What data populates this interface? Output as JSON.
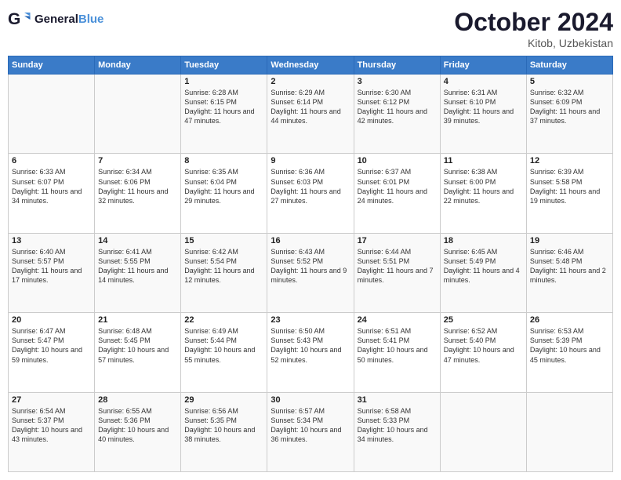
{
  "logo": {
    "text_general": "General",
    "text_blue": "Blue"
  },
  "title": "October 2024",
  "location": "Kitob, Uzbekistan",
  "days_of_week": [
    "Sunday",
    "Monday",
    "Tuesday",
    "Wednesday",
    "Thursday",
    "Friday",
    "Saturday"
  ],
  "weeks": [
    [
      {
        "day": "",
        "sunrise": "",
        "sunset": "",
        "daylight": ""
      },
      {
        "day": "",
        "sunrise": "",
        "sunset": "",
        "daylight": ""
      },
      {
        "day": "1",
        "sunrise": "Sunrise: 6:28 AM",
        "sunset": "Sunset: 6:15 PM",
        "daylight": "Daylight: 11 hours and 47 minutes."
      },
      {
        "day": "2",
        "sunrise": "Sunrise: 6:29 AM",
        "sunset": "Sunset: 6:14 PM",
        "daylight": "Daylight: 11 hours and 44 minutes."
      },
      {
        "day": "3",
        "sunrise": "Sunrise: 6:30 AM",
        "sunset": "Sunset: 6:12 PM",
        "daylight": "Daylight: 11 hours and 42 minutes."
      },
      {
        "day": "4",
        "sunrise": "Sunrise: 6:31 AM",
        "sunset": "Sunset: 6:10 PM",
        "daylight": "Daylight: 11 hours and 39 minutes."
      },
      {
        "day": "5",
        "sunrise": "Sunrise: 6:32 AM",
        "sunset": "Sunset: 6:09 PM",
        "daylight": "Daylight: 11 hours and 37 minutes."
      }
    ],
    [
      {
        "day": "6",
        "sunrise": "Sunrise: 6:33 AM",
        "sunset": "Sunset: 6:07 PM",
        "daylight": "Daylight: 11 hours and 34 minutes."
      },
      {
        "day": "7",
        "sunrise": "Sunrise: 6:34 AM",
        "sunset": "Sunset: 6:06 PM",
        "daylight": "Daylight: 11 hours and 32 minutes."
      },
      {
        "day": "8",
        "sunrise": "Sunrise: 6:35 AM",
        "sunset": "Sunset: 6:04 PM",
        "daylight": "Daylight: 11 hours and 29 minutes."
      },
      {
        "day": "9",
        "sunrise": "Sunrise: 6:36 AM",
        "sunset": "Sunset: 6:03 PM",
        "daylight": "Daylight: 11 hours and 27 minutes."
      },
      {
        "day": "10",
        "sunrise": "Sunrise: 6:37 AM",
        "sunset": "Sunset: 6:01 PM",
        "daylight": "Daylight: 11 hours and 24 minutes."
      },
      {
        "day": "11",
        "sunrise": "Sunrise: 6:38 AM",
        "sunset": "Sunset: 6:00 PM",
        "daylight": "Daylight: 11 hours and 22 minutes."
      },
      {
        "day": "12",
        "sunrise": "Sunrise: 6:39 AM",
        "sunset": "Sunset: 5:58 PM",
        "daylight": "Daylight: 11 hours and 19 minutes."
      }
    ],
    [
      {
        "day": "13",
        "sunrise": "Sunrise: 6:40 AM",
        "sunset": "Sunset: 5:57 PM",
        "daylight": "Daylight: 11 hours and 17 minutes."
      },
      {
        "day": "14",
        "sunrise": "Sunrise: 6:41 AM",
        "sunset": "Sunset: 5:55 PM",
        "daylight": "Daylight: 11 hours and 14 minutes."
      },
      {
        "day": "15",
        "sunrise": "Sunrise: 6:42 AM",
        "sunset": "Sunset: 5:54 PM",
        "daylight": "Daylight: 11 hours and 12 minutes."
      },
      {
        "day": "16",
        "sunrise": "Sunrise: 6:43 AM",
        "sunset": "Sunset: 5:52 PM",
        "daylight": "Daylight: 11 hours and 9 minutes."
      },
      {
        "day": "17",
        "sunrise": "Sunrise: 6:44 AM",
        "sunset": "Sunset: 5:51 PM",
        "daylight": "Daylight: 11 hours and 7 minutes."
      },
      {
        "day": "18",
        "sunrise": "Sunrise: 6:45 AM",
        "sunset": "Sunset: 5:49 PM",
        "daylight": "Daylight: 11 hours and 4 minutes."
      },
      {
        "day": "19",
        "sunrise": "Sunrise: 6:46 AM",
        "sunset": "Sunset: 5:48 PM",
        "daylight": "Daylight: 11 hours and 2 minutes."
      }
    ],
    [
      {
        "day": "20",
        "sunrise": "Sunrise: 6:47 AM",
        "sunset": "Sunset: 5:47 PM",
        "daylight": "Daylight: 10 hours and 59 minutes."
      },
      {
        "day": "21",
        "sunrise": "Sunrise: 6:48 AM",
        "sunset": "Sunset: 5:45 PM",
        "daylight": "Daylight: 10 hours and 57 minutes."
      },
      {
        "day": "22",
        "sunrise": "Sunrise: 6:49 AM",
        "sunset": "Sunset: 5:44 PM",
        "daylight": "Daylight: 10 hours and 55 minutes."
      },
      {
        "day": "23",
        "sunrise": "Sunrise: 6:50 AM",
        "sunset": "Sunset: 5:43 PM",
        "daylight": "Daylight: 10 hours and 52 minutes."
      },
      {
        "day": "24",
        "sunrise": "Sunrise: 6:51 AM",
        "sunset": "Sunset: 5:41 PM",
        "daylight": "Daylight: 10 hours and 50 minutes."
      },
      {
        "day": "25",
        "sunrise": "Sunrise: 6:52 AM",
        "sunset": "Sunset: 5:40 PM",
        "daylight": "Daylight: 10 hours and 47 minutes."
      },
      {
        "day": "26",
        "sunrise": "Sunrise: 6:53 AM",
        "sunset": "Sunset: 5:39 PM",
        "daylight": "Daylight: 10 hours and 45 minutes."
      }
    ],
    [
      {
        "day": "27",
        "sunrise": "Sunrise: 6:54 AM",
        "sunset": "Sunset: 5:37 PM",
        "daylight": "Daylight: 10 hours and 43 minutes."
      },
      {
        "day": "28",
        "sunrise": "Sunrise: 6:55 AM",
        "sunset": "Sunset: 5:36 PM",
        "daylight": "Daylight: 10 hours and 40 minutes."
      },
      {
        "day": "29",
        "sunrise": "Sunrise: 6:56 AM",
        "sunset": "Sunset: 5:35 PM",
        "daylight": "Daylight: 10 hours and 38 minutes."
      },
      {
        "day": "30",
        "sunrise": "Sunrise: 6:57 AM",
        "sunset": "Sunset: 5:34 PM",
        "daylight": "Daylight: 10 hours and 36 minutes."
      },
      {
        "day": "31",
        "sunrise": "Sunrise: 6:58 AM",
        "sunset": "Sunset: 5:33 PM",
        "daylight": "Daylight: 10 hours and 34 minutes."
      },
      {
        "day": "",
        "sunrise": "",
        "sunset": "",
        "daylight": ""
      },
      {
        "day": "",
        "sunrise": "",
        "sunset": "",
        "daylight": ""
      }
    ]
  ]
}
